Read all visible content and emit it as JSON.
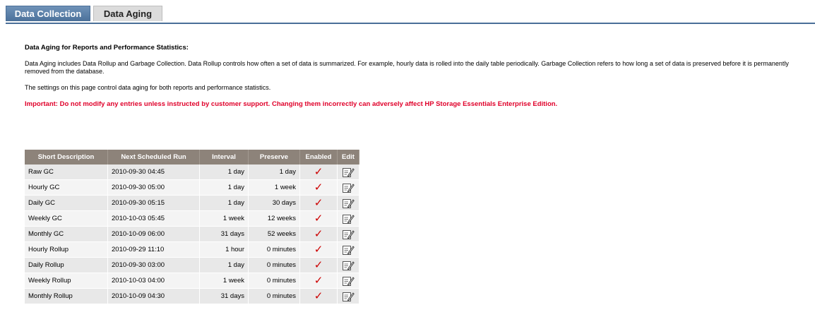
{
  "tabs": [
    {
      "label": "Data Collection",
      "active": true
    },
    {
      "label": "Data Aging",
      "active": false
    }
  ],
  "content": {
    "heading": "Data Aging for Reports and Performance Statistics:",
    "paragraph1": "Data Aging includes Data Rollup and Garbage Collection. Data Rollup controls how often a set of data is summarized. For example, hourly data is rolled into the daily table periodically. Garbage Collection refers to how long a set of data is preserved before it is permanently removed from the database.",
    "paragraph2": "The settings on this page control data aging for both reports and performance statistics.",
    "important": "Important: Do not modify any entries unless instructed by customer support. Changing them incorrectly can adversely affect HP Storage Essentials Enterprise Edition."
  },
  "table": {
    "headers": [
      "Short Description",
      "Next Scheduled Run",
      "Interval",
      "Preserve",
      "Enabled",
      "Edit"
    ],
    "rows": [
      {
        "desc": "Raw GC",
        "run": "2010-09-30 04:45",
        "interval": "1 day",
        "preserve": "1 day",
        "enabled": "✓"
      },
      {
        "desc": "Hourly GC",
        "run": "2010-09-30 05:00",
        "interval": "1 day",
        "preserve": "1 week",
        "enabled": "✓"
      },
      {
        "desc": "Daily GC",
        "run": "2010-09-30 05:15",
        "interval": "1 day",
        "preserve": "30 days",
        "enabled": "✓"
      },
      {
        "desc": "Weekly GC",
        "run": "2010-10-03 05:45",
        "interval": "1 week",
        "preserve": "12 weeks",
        "enabled": "✓"
      },
      {
        "desc": "Monthly GC",
        "run": "2010-10-09 06:00",
        "interval": "31 days",
        "preserve": "52 weeks",
        "enabled": "✓"
      },
      {
        "desc": "Hourly Rollup",
        "run": "2010-09-29 11:10",
        "interval": "1 hour",
        "preserve": "0 minutes",
        "enabled": "✓"
      },
      {
        "desc": "Daily Rollup",
        "run": "2010-09-30 03:00",
        "interval": "1 day",
        "preserve": "0 minutes",
        "enabled": "✓"
      },
      {
        "desc": "Weekly Rollup",
        "run": "2010-10-03 04:00",
        "interval": "1 week",
        "preserve": "0 minutes",
        "enabled": "✓"
      },
      {
        "desc": "Monthly Rollup",
        "run": "2010-10-09 04:30",
        "interval": "31 days",
        "preserve": "0 minutes",
        "enabled": "✓"
      }
    ]
  },
  "colors": {
    "active_tab": "#4d739c",
    "header_bg": "#8d837a",
    "important_text": "#e0002a",
    "check": "#cc0000"
  },
  "icons": {
    "enabled": "checkmark-icon",
    "edit": "edit-icon"
  }
}
